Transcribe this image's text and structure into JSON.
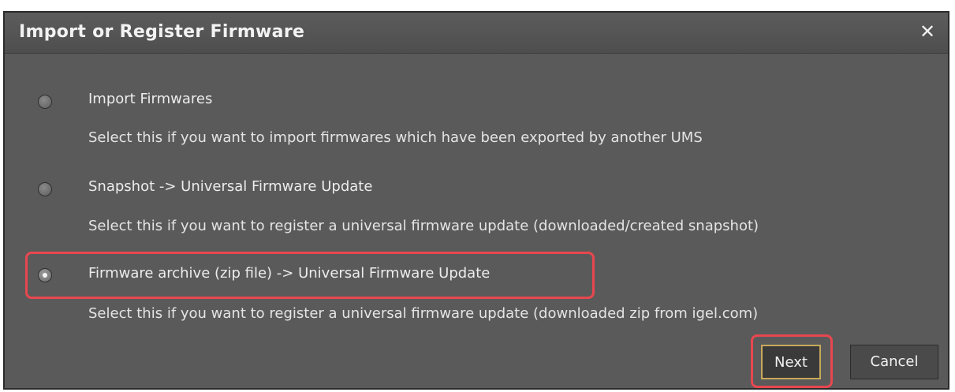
{
  "dialog": {
    "title": "Import or Register Firmware",
    "close_glyph": "✕"
  },
  "options": [
    {
      "label": "Import Firmwares",
      "description": "Select this if you want to import firmwares which have been exported by another UMS",
      "selected": false
    },
    {
      "label": "Snapshot -> Universal Firmware Update",
      "description": "Select this if you want to register a universal firmware update (downloaded/created snapshot)",
      "selected": false
    },
    {
      "label": "Firmware archive (zip file) -> Universal Firmware Update",
      "description": "Select this if you want to register a universal firmware update (downloaded zip from igel.com)",
      "selected": true
    }
  ],
  "buttons": {
    "next_label": "Next",
    "cancel_label": "Cancel"
  },
  "colors": {
    "dialog_bg": "#5a5a5a",
    "highlight": "#e8474f",
    "focus_border": "#c8a85a"
  }
}
